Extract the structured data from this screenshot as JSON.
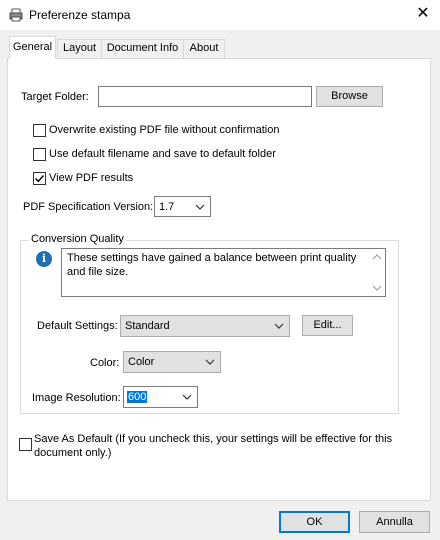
{
  "window": {
    "title": "Preferenze stampa",
    "close_glyph": "✕",
    "icon": "printer-icon"
  },
  "tabs": [
    {
      "label": "General",
      "active": true
    },
    {
      "label": "Layout",
      "active": false
    },
    {
      "label": "Document Info",
      "active": false
    },
    {
      "label": "About",
      "active": false
    }
  ],
  "general": {
    "target_folder": {
      "label": "Target Folder:",
      "value": "",
      "browse_label": "Browse"
    },
    "options": [
      {
        "label": "Overwrite existing PDF file without confirmation",
        "checked": false
      },
      {
        "label": "Use default filename and save to default folder",
        "checked": false
      },
      {
        "label": "View PDF results",
        "checked": true
      }
    ],
    "pdf_version": {
      "label": "PDF Specification Version:",
      "value": "1.7"
    },
    "conversion_quality": {
      "title": "Conversion Quality",
      "info_icon_glyph": "i",
      "info_text": "These settings have gained a balance between print quality and file size.",
      "default_settings": {
        "label": "Default Settings:",
        "value": "Standard",
        "edit_label": "Edit..."
      },
      "color": {
        "label": "Color:",
        "value": "Color"
      },
      "image_resolution": {
        "label": "Image Resolution:",
        "value": "600"
      }
    },
    "save_as_default": {
      "label": "Save As Default (If you uncheck this, your settings will be effective for this document only.)",
      "checked": false
    }
  },
  "footer": {
    "ok_label": "OK",
    "cancel_label": "Annulla"
  },
  "colors": {
    "accent": "#0078d7",
    "info_blue": "#1e6fb3",
    "window_bg": "#f0f0f0",
    "panel_bg": "#ffffff"
  }
}
